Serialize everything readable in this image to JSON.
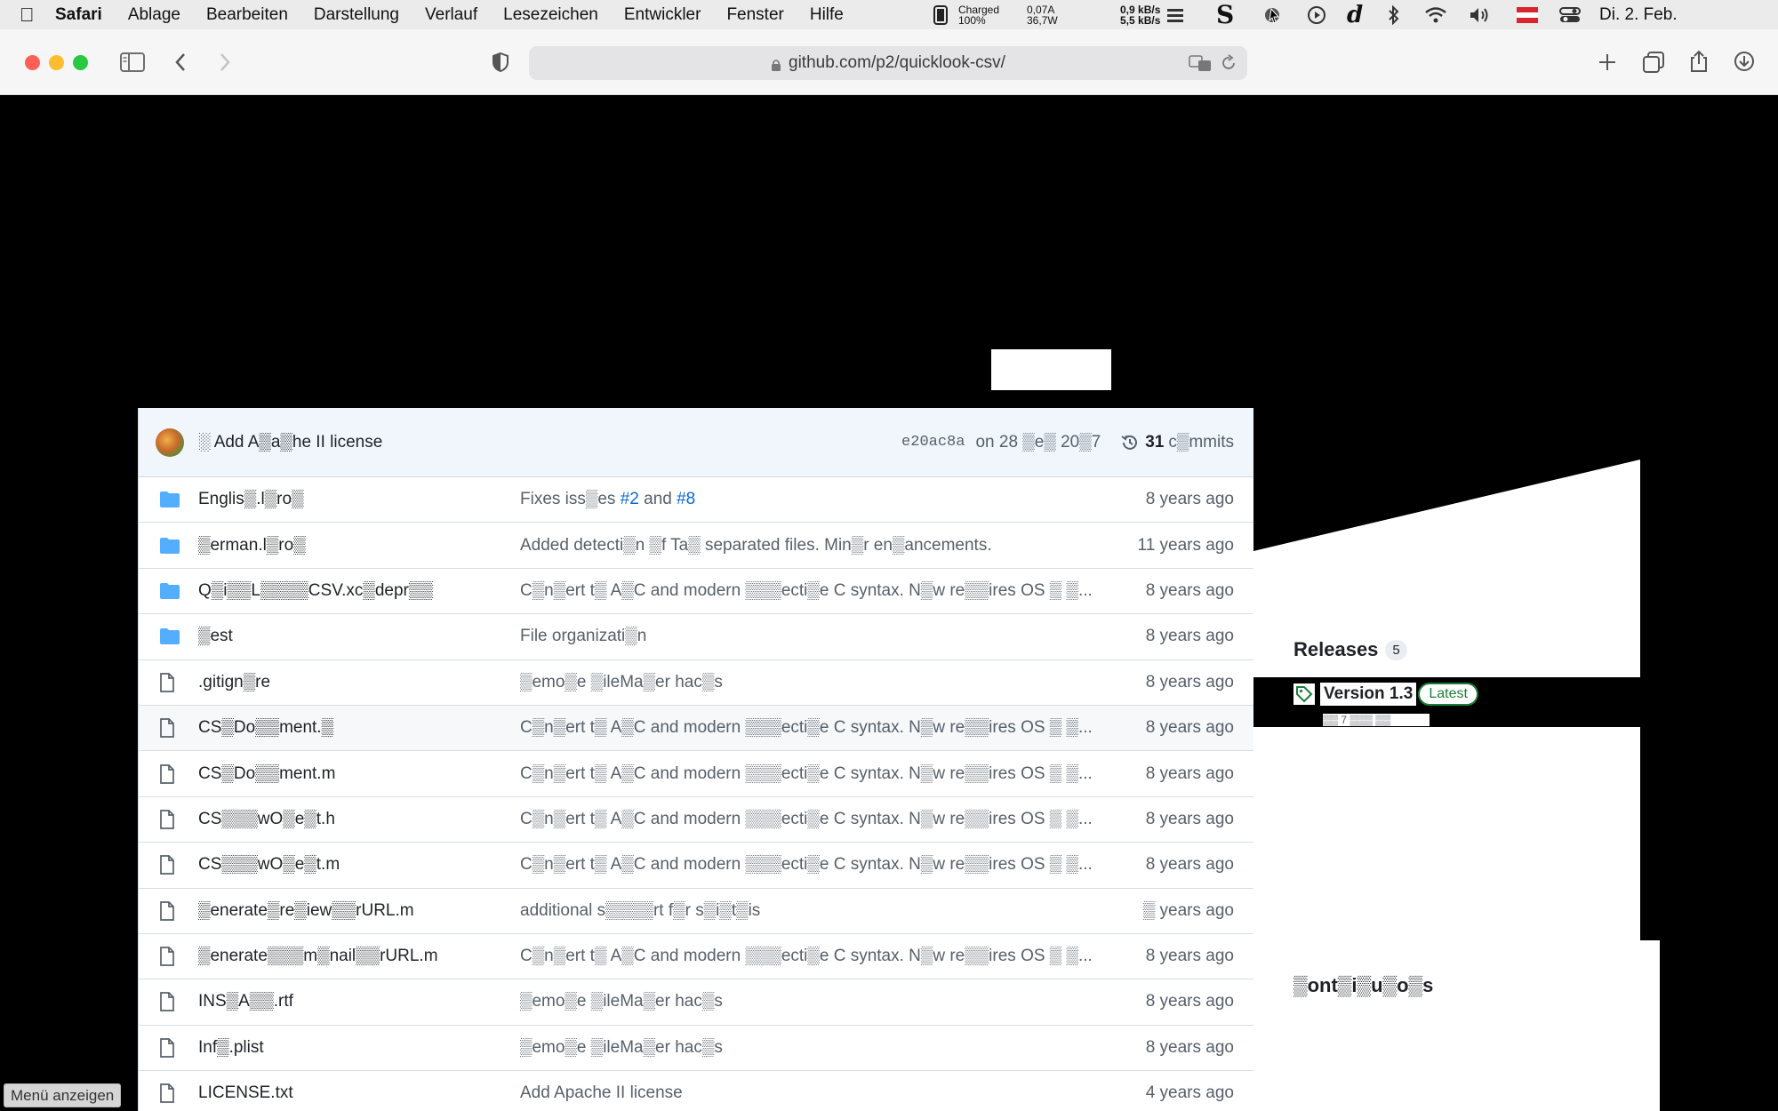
{
  "menubar": {
    "app": "Safari",
    "items": [
      "Ablage",
      "Bearbeiten",
      "Darstellung",
      "Verlauf",
      "Lesezeichen",
      "Entwickler",
      "Fenster",
      "Hilfe"
    ],
    "battery_top": "Charged",
    "battery_bottom": "100%",
    "power_top": "0,07A",
    "power_bottom": "36,7W",
    "net_top": "0,9 kB/s",
    "net_bottom": "5,5 kB/s",
    "clock": "Di. 2. Feb."
  },
  "browser": {
    "url": "github.com/p2/quicklook-csv/"
  },
  "latest_commit": {
    "message": "░ Add A▒a▒he II license",
    "sha": "e20ac8a",
    "date": "on 28 ▒e▒ 20▒7",
    "count": "31",
    "count_label": "c▒mmits"
  },
  "files": [
    {
      "type": "folder",
      "name": "Englis▒.l▒ro▒",
      "msg_pre": "Fixes iss▒es ",
      "link1": "#2",
      "msg_mid": " and ",
      "link2": "#8",
      "age": "8 years ago"
    },
    {
      "type": "folder",
      "name": "▒erman.l▒ro▒",
      "msg": "Added detecti▒n ▒f Ta▒ separated files. Min▒r en▒ancements.",
      "age": "11 years ago"
    },
    {
      "type": "folder",
      "name": "Q▒i▒▒L▒▒▒▒CSV.xc▒depr▒▒",
      "msg": "C▒n▒ert t▒ A▒C and modern ▒▒▒ecti▒e C syntax. N▒w re▒▒ires OS ▒ ▒...",
      "age": "8 years ago"
    },
    {
      "type": "folder",
      "name": "▒est",
      "msg": "File organizati▒n",
      "age": "8 years ago"
    },
    {
      "type": "file",
      "name": ".gitign▒re",
      "msg": "▒emo▒e ▒ileMa▒er hac▒s",
      "age": "8 years ago"
    },
    {
      "type": "file",
      "name": "CS▒Do▒▒ment.▒",
      "msg": "C▒n▒ert t▒ A▒C and modern ▒▒▒ecti▒e C syntax. N▒w re▒▒ires OS ▒ ▒...",
      "age": "8 years ago",
      "hover": true
    },
    {
      "type": "file",
      "name": "CS▒Do▒▒ment.m",
      "msg": "C▒n▒ert t▒ A▒C and modern ▒▒▒ecti▒e C syntax. N▒w re▒▒ires OS ▒ ▒...",
      "age": "8 years ago"
    },
    {
      "type": "file",
      "name": "CS▒▒▒wO▒e▒t.h",
      "msg": "C▒n▒ert t▒ A▒C and modern ▒▒▒ecti▒e C syntax. N▒w re▒▒ires OS ▒ ▒...",
      "age": "8 years ago"
    },
    {
      "type": "file",
      "name": "CS▒▒▒wO▒e▒t.m",
      "msg": "C▒n▒ert t▒ A▒C and modern ▒▒▒ecti▒e C syntax. N▒w re▒▒ires OS ▒ ▒...",
      "age": "8 years ago"
    },
    {
      "type": "file",
      "name": "▒enerate▒re▒iew▒▒rURL.m",
      "msg": "additional s▒▒▒▒rt f▒r s▒i▒t▒is",
      "age": "▒ years ago"
    },
    {
      "type": "file",
      "name": "▒enerate▒▒▒m▒nail▒▒rURL.m",
      "msg": "C▒n▒ert t▒ A▒C and modern ▒▒▒ecti▒e C syntax. N▒w re▒▒ires OS ▒ ▒...",
      "age": "8 years ago"
    },
    {
      "type": "file",
      "name": "INS▒A▒▒.rtf",
      "msg": "▒emo▒e ▒ileMa▒er hac▒s",
      "age": "8 years ago"
    },
    {
      "type": "file",
      "name": "Inf▒.plist",
      "msg": "▒emo▒e ▒ileMa▒er hac▒s",
      "age": "8 years ago"
    },
    {
      "type": "file",
      "name": "LICENSE.txt",
      "msg": "Add Apache II license",
      "age": "4 years ago"
    }
  ],
  "sidebar": {
    "releases_title": "Releases",
    "releases_count": "5",
    "latest_release": "Version 1.3",
    "latest_badge": "Latest",
    "release_sub": "▒▒ 7 ▒▒▒ ▒▒",
    "contributors_title": "▒ont▒i▒u▒o▒s"
  },
  "tooltip": "Menü anzeigen"
}
